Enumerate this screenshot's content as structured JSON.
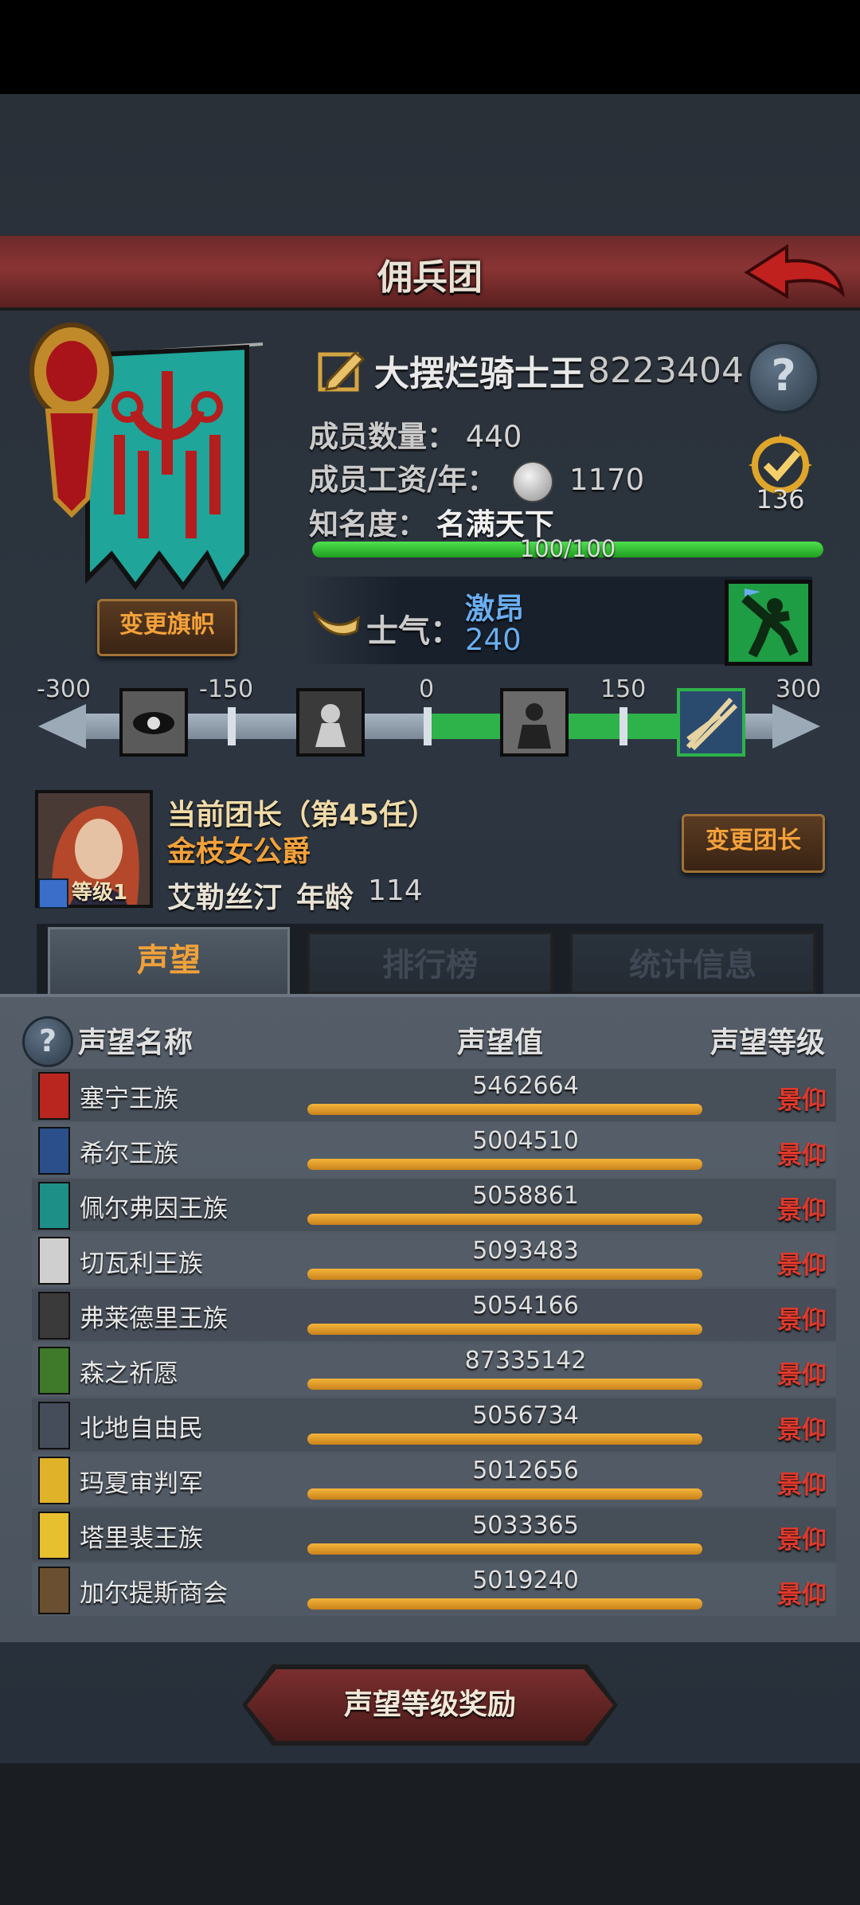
{
  "title": "佣兵团",
  "company": {
    "name": "大摆烂骑士王",
    "id": "8223404",
    "members_label": "成员数量：",
    "members": "440",
    "salary_label": "成员工资/年：",
    "salary": "1170",
    "fame_label": "知名度：",
    "fame_value": "名满天下",
    "fame_progress_text": "100/100",
    "fame_progress": 1.0,
    "badge_number": "136",
    "change_flag_label": "变更旗帜",
    "morale_label": "士气：",
    "morale_state": "激昂",
    "morale_value": "240"
  },
  "morale_scale": {
    "ticks": [
      "-300",
      "-150",
      "0",
      "150",
      "300"
    ]
  },
  "leader": {
    "title": "当前团长（第45任）",
    "rank": "金枝女公爵",
    "name": "艾勒丝汀",
    "age_label": "年龄",
    "age": "114",
    "level": "等级1",
    "change_leader_label": "变更团长"
  },
  "tabs": [
    {
      "label": "声望",
      "active": true
    },
    {
      "label": "排行榜",
      "active": false
    },
    {
      "label": "统计信息",
      "active": false
    }
  ],
  "table": {
    "headers": {
      "name": "声望名称",
      "value": "声望值",
      "level": "声望等级"
    },
    "rows": [
      {
        "name": "塞宁王族",
        "value": "5462664",
        "level": "景仰",
        "color": "#b8261f"
      },
      {
        "name": "希尔王族",
        "value": "5004510",
        "level": "景仰",
        "color": "#2a4f8a"
      },
      {
        "name": "佩尔弗因王族",
        "value": "5058861",
        "level": "景仰",
        "color": "#1e8f86"
      },
      {
        "name": "切瓦利王族",
        "value": "5093483",
        "level": "景仰",
        "color": "#cfcfcf"
      },
      {
        "name": "弗莱德里王族",
        "value": "5054166",
        "level": "景仰",
        "color": "#3a3a3a"
      },
      {
        "name": "森之祈愿",
        "value": "87335142",
        "level": "景仰",
        "color": "#3f7a2a"
      },
      {
        "name": "北地自由民",
        "value": "5056734",
        "level": "景仰",
        "color": "#454d5a"
      },
      {
        "name": "玛夏审判军",
        "value": "5012656",
        "level": "景仰",
        "color": "#e0b22a"
      },
      {
        "name": "塔里裴王族",
        "value": "5033365",
        "level": "景仰",
        "color": "#e6c02e"
      },
      {
        "name": "加尔提斯商会",
        "value": "5019240",
        "level": "景仰",
        "color": "#6a5030"
      }
    ]
  },
  "bottom_button": "声望等级奖励"
}
